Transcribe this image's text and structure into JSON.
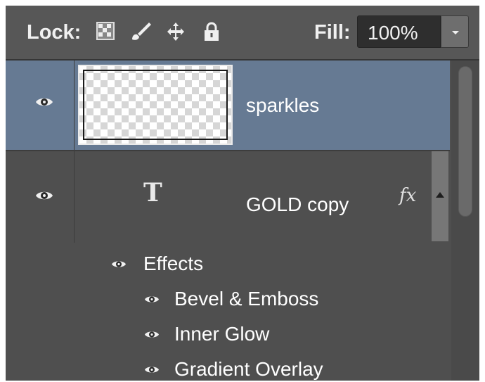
{
  "lock_bar": {
    "lock_label": "Lock:",
    "lock_icons": [
      "lock-transparent-pixels-icon",
      "lock-image-pixels-icon",
      "lock-position-icon",
      "lock-all-icon"
    ],
    "fill_label": "Fill:",
    "fill_value": "100%"
  },
  "layers": [
    {
      "name": "sparkles",
      "selected": true,
      "type": "pixel",
      "visible": true
    },
    {
      "name": "GOLD copy",
      "type": "text",
      "type_icon": "T",
      "fx_label": "fx",
      "visible": true,
      "effects_label": "Effects",
      "effects": [
        {
          "name": "Bevel & Emboss"
        },
        {
          "name": "Inner Glow"
        },
        {
          "name": "Gradient Overlay"
        }
      ]
    }
  ],
  "colors": {
    "panel_bg": "#4f4f4f",
    "selected_row": "#667a93",
    "text": "#ffffff"
  }
}
